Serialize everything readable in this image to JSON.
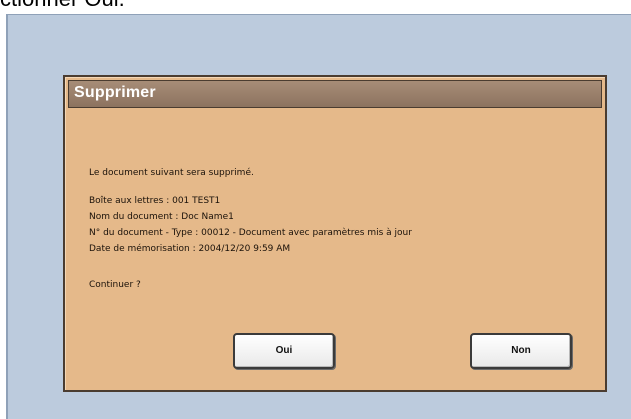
{
  "header_text": "ctionner Oui.",
  "dialog": {
    "title": "Supprimer",
    "intro": "Le document suivant sera supprimé.",
    "details": [
      "Boîte aux lettres : 001 TEST1",
      "Nom du document : Doc Name1",
      "N° du document - Type : 00012 - Document avec paramètres mis à jour",
      "Date de mémorisation : 2004/12/20 9:59 AM"
    ],
    "question": "Continuer ?",
    "buttons": {
      "yes": "Oui",
      "no": "Non"
    }
  },
  "colors": {
    "screen_background": "#bccbdd",
    "dialog_background": "#e5b98a",
    "titlebar": "#9a806a"
  }
}
